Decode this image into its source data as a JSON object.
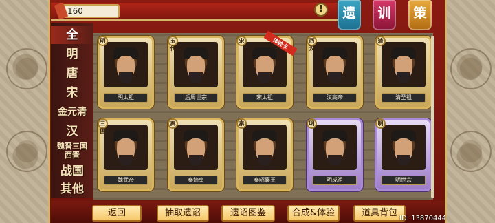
{
  "counter": {
    "value": "160"
  },
  "info_icon": "!",
  "banners": [
    "遗",
    "训",
    "策"
  ],
  "tabs": [
    {
      "label": "全",
      "active": true
    },
    {
      "label": "明"
    },
    {
      "label": "唐"
    },
    {
      "label": "宋"
    },
    {
      "label": "金元清"
    },
    {
      "label": "汉"
    },
    {
      "label": "魏晋三国西晋"
    },
    {
      "label": "战国"
    },
    {
      "label": "其他"
    }
  ],
  "cards": [
    {
      "name": "明太祖",
      "dynasty": "明",
      "purple": false
    },
    {
      "name": "后周世宗",
      "dynasty": "五代",
      "purple": false
    },
    {
      "name": "宋太祖",
      "dynasty": "宋",
      "purple": false,
      "trial": "体验卡"
    },
    {
      "name": "汉高帝",
      "dynasty": "西汉",
      "purple": false
    },
    {
      "name": "清圣祖",
      "dynasty": "清",
      "purple": false
    },
    {
      "name": "魏武帝",
      "dynasty": "三国",
      "purple": false
    },
    {
      "name": "秦始皇",
      "dynasty": "秦",
      "purple": false
    },
    {
      "name": "秦昭襄王",
      "dynasty": "秦",
      "purple": false
    },
    {
      "name": "明成祖",
      "dynasty": "明",
      "purple": true
    },
    {
      "name": "明世宗",
      "dynasty": "明",
      "purple": true
    }
  ],
  "buttons": [
    "返回",
    "抽取遗诏",
    "遗诏图鉴",
    "合成&体验",
    "道具背包"
  ],
  "user_id": "ID: 13870444"
}
